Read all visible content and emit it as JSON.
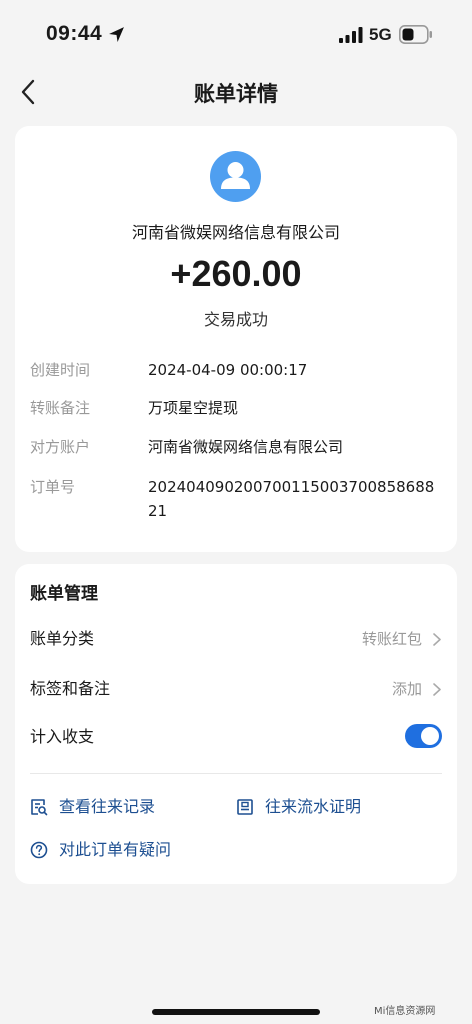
{
  "status_bar": {
    "time": "09:44",
    "network": "5G"
  },
  "nav": {
    "title": "账单详情"
  },
  "detail": {
    "merchant": "河南省微娱网络信息有限公司",
    "amount": "+260.00",
    "status": "交易成功",
    "rows": [
      {
        "label": "创建时间",
        "value": "2024-04-09 00:00:17"
      },
      {
        "label": "转账备注",
        "value": "万项星空提现"
      },
      {
        "label": "对方账户",
        "value": "河南省微娱网络信息有限公司"
      },
      {
        "label": "订单号",
        "value": "202404090200700115003700858688 21"
      }
    ]
  },
  "manage": {
    "title": "账单管理",
    "category_label": "账单分类",
    "category_value": "转账红包",
    "tags_label": "标签和备注",
    "tags_value": "添加",
    "include_label": "计入收支",
    "include_enabled": true,
    "link_records": "查看往来记录",
    "link_proof": "往来流水证明",
    "link_question": "对此订单有疑问"
  },
  "watermark": "Mi信息资源网",
  "colors": {
    "accent": "#1f6fe0",
    "link": "#1d4f91",
    "avatar": "#4f9ff0"
  }
}
